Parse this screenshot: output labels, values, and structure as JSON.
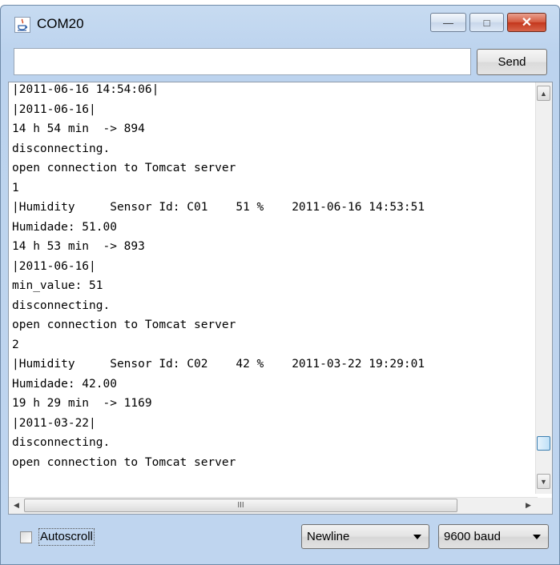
{
  "window": {
    "title": "COM20"
  },
  "titlebar": {
    "min_symbol": "—",
    "max_symbol": "□",
    "close_symbol": "✕"
  },
  "send": {
    "input_value": "",
    "button_label": "Send"
  },
  "console": {
    "lines": [
      "|2011-06-16 14:54:06|",
      "|2011-06-16|",
      "14 h 54 min  -> 894",
      "disconnecting.",
      "open connection to Tomcat server",
      "1",
      "|Humidity     Sensor Id: C01    51 %    2011-06-16 14:53:51",
      "Humidade: 51.00",
      "14 h 53 min  -> 893",
      "|2011-06-16|",
      "min_value: 51",
      "disconnecting.",
      "open connection to Tomcat server",
      "2",
      "|Humidity     Sensor Id: C02    42 %    2011-03-22 19:29:01",
      "Humidade: 42.00",
      "19 h 29 min  -> 1169",
      "|2011-03-22|",
      "disconnecting.",
      "open connection to Tomcat server"
    ]
  },
  "scrollbar": {
    "up": "▲",
    "down": "▼",
    "left": "◀",
    "right": "▶",
    "grip": "III"
  },
  "bottom": {
    "autoscroll_label": "Autoscroll",
    "autoscroll_checked": false,
    "line_ending": "Newline",
    "baud_rate": "9600 baud"
  },
  "colors": {
    "window_frame": "#bfd5ef",
    "close_button": "#c3371c",
    "console_bg": "#ffffff"
  }
}
